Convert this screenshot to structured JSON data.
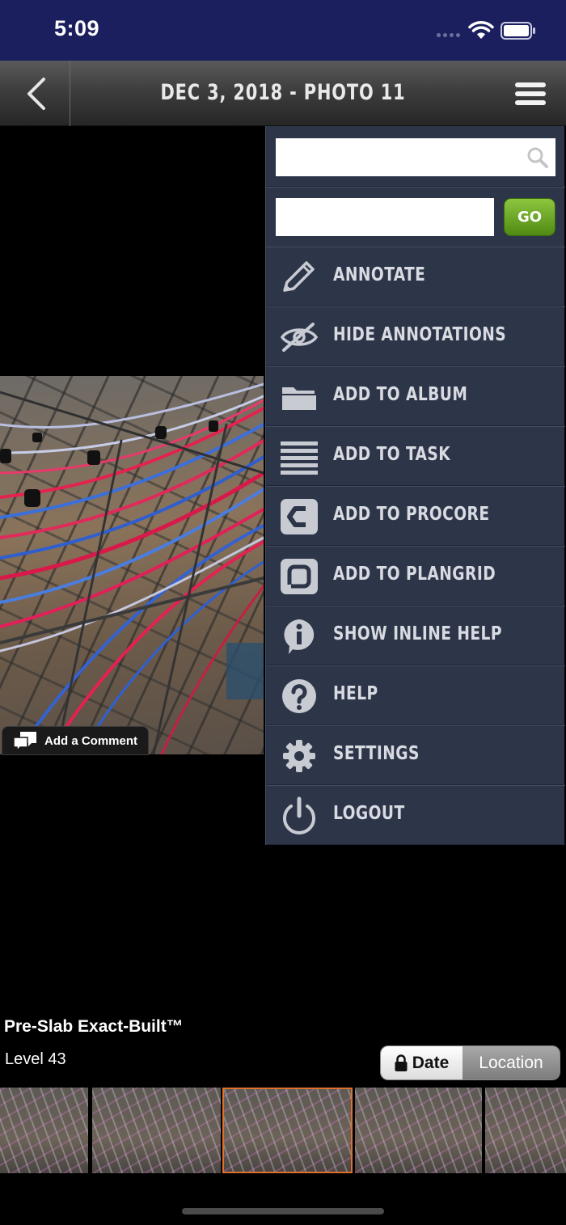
{
  "status_bar": {
    "time": "5:09"
  },
  "nav": {
    "title": "DEC 3, 2018 - PHOTO 11"
  },
  "menu": {
    "search_placeholder": "",
    "go_input_value": "",
    "go_label": "GO",
    "items": [
      {
        "label": "ANNOTATE",
        "icon": "pencil-icon"
      },
      {
        "label": "HIDE ANNOTATIONS",
        "icon": "eye-slash-icon"
      },
      {
        "label": "ADD TO ALBUM",
        "icon": "folder-icon"
      },
      {
        "label": "ADD TO TASK",
        "icon": "list-lines-icon"
      },
      {
        "label": "ADD TO PROCORE",
        "icon": "procore-icon"
      },
      {
        "label": "ADD TO PLANGRID",
        "icon": "plangrid-icon"
      },
      {
        "label": "SHOW INLINE HELP",
        "icon": "info-bubble-icon"
      },
      {
        "label": "HELP",
        "icon": "question-icon"
      },
      {
        "label": "SETTINGS",
        "icon": "gear-icon"
      },
      {
        "label": "LOGOUT",
        "icon": "power-icon"
      }
    ]
  },
  "photo": {
    "comment_label": "Add a Comment"
  },
  "info": {
    "title": "Pre-Slab Exact-Built™",
    "subtitle": "Level 43"
  },
  "sort": {
    "date_label": "Date",
    "location_label": "Location",
    "selected": "Date"
  },
  "thumbnails": {
    "count": 5,
    "active_index": 2
  },
  "colors": {
    "status_bar": "#1b1f5e",
    "menu_bg": "#2d3548",
    "go_green": "#6aa52a",
    "active_thumb": "#e0702a"
  }
}
